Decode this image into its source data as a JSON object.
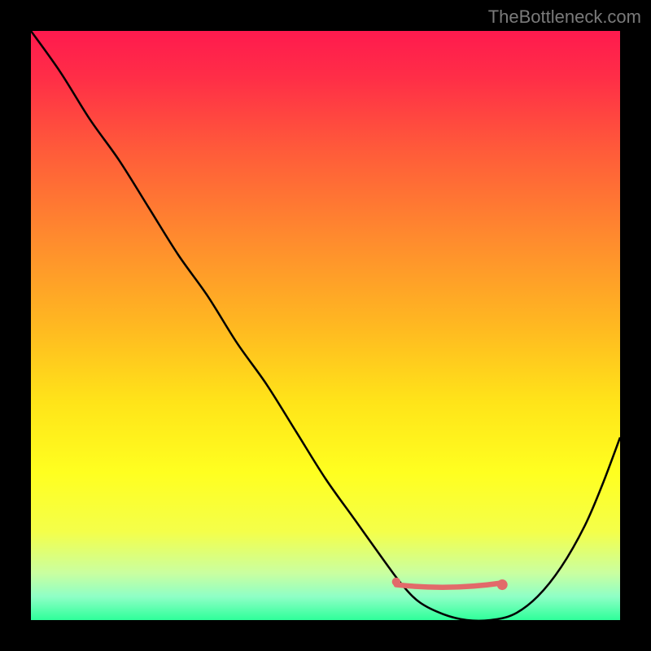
{
  "watermark": "TheBottleneck.com",
  "chart_data": {
    "type": "line",
    "title": "",
    "xlabel": "",
    "ylabel": "",
    "xlim": [
      0,
      100
    ],
    "ylim": [
      0,
      100
    ],
    "grid": false,
    "legend_position": "none",
    "background_gradient": {
      "stops": [
        {
          "offset": 0.0,
          "color": "#ff1a4e"
        },
        {
          "offset": 0.08,
          "color": "#ff2e47"
        },
        {
          "offset": 0.2,
          "color": "#ff5a3a"
        },
        {
          "offset": 0.35,
          "color": "#ff8a2e"
        },
        {
          "offset": 0.5,
          "color": "#ffb821"
        },
        {
          "offset": 0.63,
          "color": "#ffe419"
        },
        {
          "offset": 0.75,
          "color": "#ffff20"
        },
        {
          "offset": 0.85,
          "color": "#f4ff4a"
        },
        {
          "offset": 0.92,
          "color": "#caffa0"
        },
        {
          "offset": 0.96,
          "color": "#8fffc6"
        },
        {
          "offset": 1.0,
          "color": "#2eff9a"
        }
      ]
    },
    "series": [
      {
        "name": "bottleneck-curve",
        "color": "#000000",
        "width": 2,
        "x": [
          0,
          5,
          10,
          15,
          20,
          25,
          30,
          35,
          40,
          45,
          50,
          55,
          60,
          63,
          66,
          70,
          74,
          78,
          82,
          86,
          90,
          94,
          97,
          100
        ],
        "y": [
          100,
          93,
          85,
          78,
          70,
          62,
          55,
          47,
          40,
          32,
          24,
          17,
          10,
          6,
          3,
          1,
          0,
          0,
          1,
          4,
          9,
          16,
          23,
          31
        ]
      }
    ],
    "markers": [
      {
        "name": "optimal-range-start",
        "x": 62,
        "y": 6.5,
        "r": 4,
        "color": "#e26a6a"
      },
      {
        "name": "optimal-range-end",
        "x": 80,
        "y": 6.0,
        "r": 5,
        "color": "#e26a6a"
      }
    ],
    "optimal_band": {
      "x_start": 62,
      "x_end": 80,
      "y": 6,
      "thickness": 4,
      "color": "#e26a6a"
    }
  }
}
